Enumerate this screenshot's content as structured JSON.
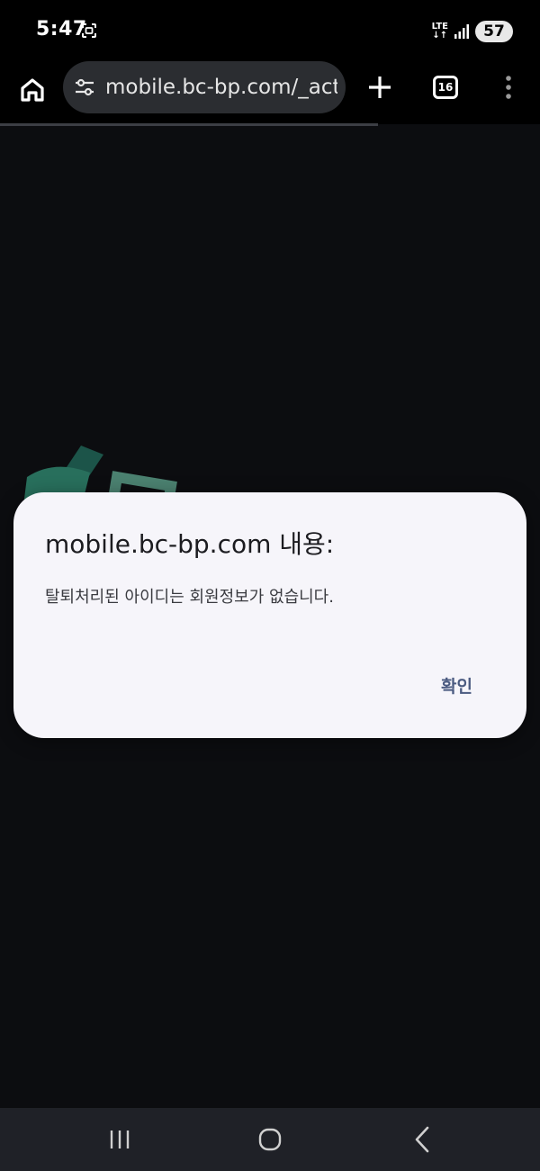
{
  "status_bar": {
    "time": "5:47",
    "network_top": "LTE",
    "network_bottom": "↓↑",
    "battery": "57",
    "screenshot_icon": "screenshot-icon",
    "signal_icon": "signal-icon"
  },
  "browser": {
    "url": "mobile.bc-bp.com/_action/login",
    "tab_count": "16",
    "home_icon": "home-icon",
    "site_settings_icon": "tune-icon",
    "new_tab_icon": "plus-icon",
    "menu_icon": "more-vert-icon"
  },
  "dialog": {
    "title": "mobile.bc-bp.com 내용:",
    "message": "탈퇴처리된 아이디는 회원정보가 없습니다.",
    "ok_label": "확인"
  },
  "nav_bar": {
    "recents_icon": "recents-icon",
    "home_icon": "home-circle-icon",
    "back_icon": "back-chevron-icon"
  },
  "colors": {
    "background": "#0c0d10",
    "dialog_bg": "#f6f5fa",
    "url_bar_bg": "#2b2d31",
    "nav_bar_bg": "#1f2127",
    "ok_button": "#4a5a80",
    "watermark": "#7fe0c0"
  }
}
